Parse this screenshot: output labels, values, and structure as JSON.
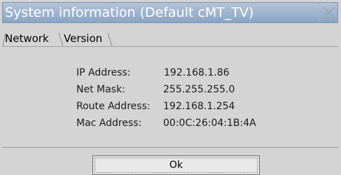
{
  "window": {
    "title": "System information (Default cMT_TV)",
    "close_icon": "close-icon"
  },
  "tabs": [
    {
      "label": "Network",
      "active": true
    },
    {
      "label": "Version",
      "active": false
    }
  ],
  "network_info": [
    {
      "label": "IP Address:",
      "value": "192.168.1.86"
    },
    {
      "label": "Net Mask:",
      "value": "255.255.255.0"
    },
    {
      "label": "Route Address:",
      "value": "192.168.1.254"
    },
    {
      "label": "Mac Address:",
      "value": "00:0C:26:04:1B:4A"
    }
  ],
  "buttons": {
    "ok_label": "Ok"
  },
  "colors": {
    "titlebar": "#8aa4c4",
    "background": "#d4d4d4"
  }
}
